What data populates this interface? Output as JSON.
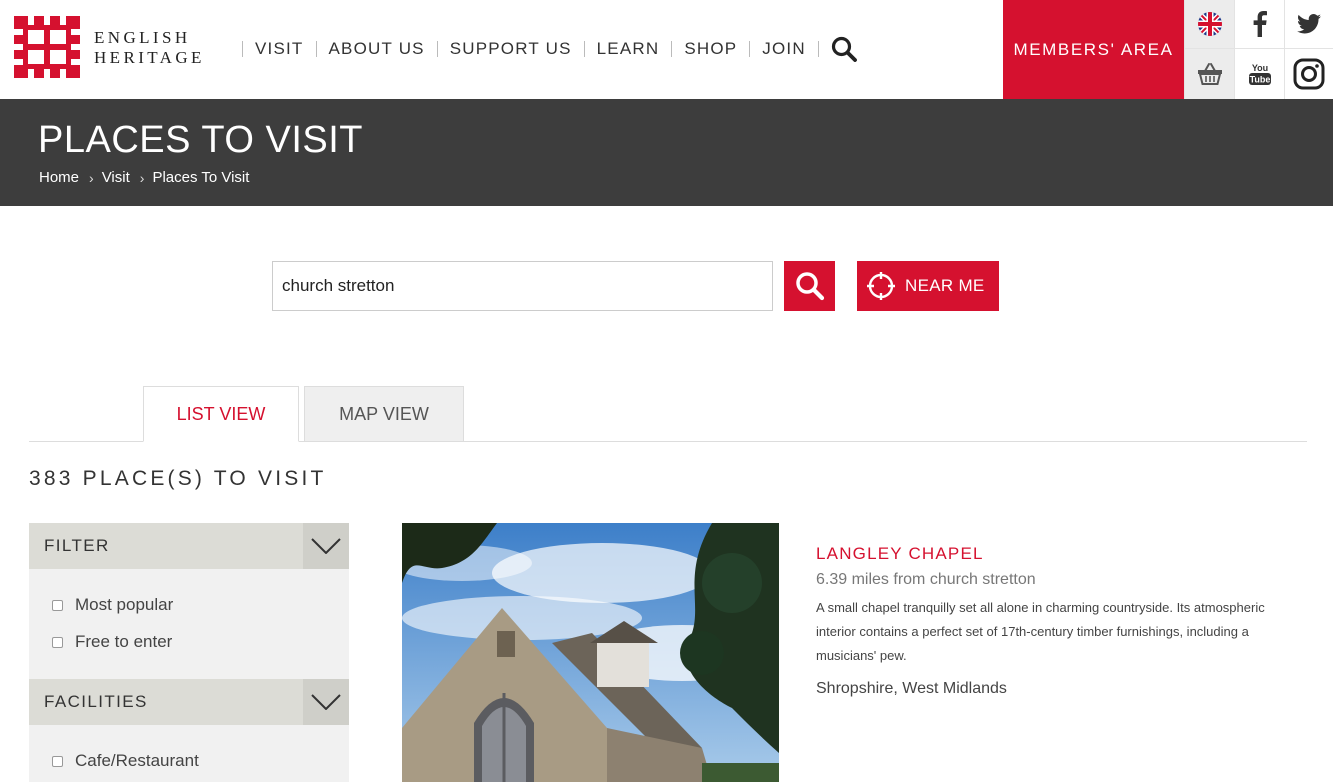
{
  "brand": {
    "line1": "ENGLISH",
    "line2": "HERITAGE"
  },
  "nav": {
    "items": [
      "VISIT",
      "ABOUT US",
      "SUPPORT US",
      "LEARN",
      "SHOP",
      "JOIN"
    ],
    "members_label": "MEMBERS' AREA"
  },
  "social": {
    "youtube_you": "You",
    "youtube_tube": "Tube"
  },
  "banner": {
    "title": "PLACES TO VISIT",
    "breadcrumbs": [
      "Home",
      "Visit",
      "Places To Visit"
    ]
  },
  "search": {
    "value": "church stretton",
    "near_me_label": "NEAR ME"
  },
  "tabs": {
    "list_label": "LIST VIEW",
    "map_label": "MAP VIEW"
  },
  "results_count": "383 PLACE(S) TO VISIT",
  "filters": {
    "filter_title": "FILTER",
    "filter_options": [
      "Most popular",
      "Free to enter"
    ],
    "facilities_title": "FACILITIES",
    "facilities_options": [
      "Cafe/Restaurant"
    ]
  },
  "result": {
    "title": "LANGLEY CHAPEL",
    "distance": "6.39 miles from church stretton",
    "description": "A small chapel tranquilly set all alone in charming countryside. Its atmospheric interior contains a perfect set of 17th-century timber furnishings, including a musicians' pew.",
    "location": "Shropshire, West Midlands"
  },
  "colors": {
    "brand_red": "#d5112f",
    "banner_dark": "#3d3d3d"
  }
}
